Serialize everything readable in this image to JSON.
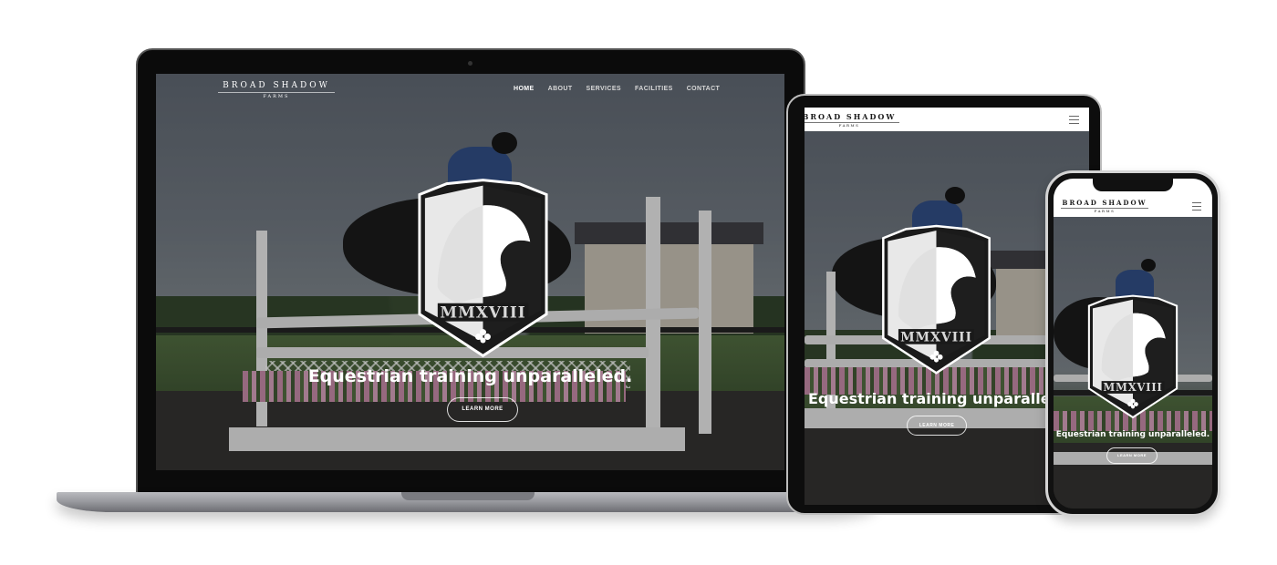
{
  "site": {
    "logo_main": "BROAD SHADOW",
    "logo_sub": "FARMS"
  },
  "nav": {
    "items": [
      {
        "label": "HOME",
        "active": true
      },
      {
        "label": "ABOUT",
        "active": false
      },
      {
        "label": "SERVICES",
        "active": false
      },
      {
        "label": "FACILITIES",
        "active": false
      },
      {
        "label": "CONTACT",
        "active": false
      }
    ]
  },
  "hero": {
    "crest_text": "MMXVIII",
    "title": "Equestrian training unparalleled.",
    "button_label": "LEARN MORE"
  },
  "icons": {
    "menu": "hamburger-menu-icon",
    "emblem": "horse-crest-icon",
    "clover": "clover-icon"
  },
  "colors": {
    "overlay_text": "#ffffff",
    "rider_jacket": "#2c4a84",
    "header_bg": "#ffffff"
  }
}
